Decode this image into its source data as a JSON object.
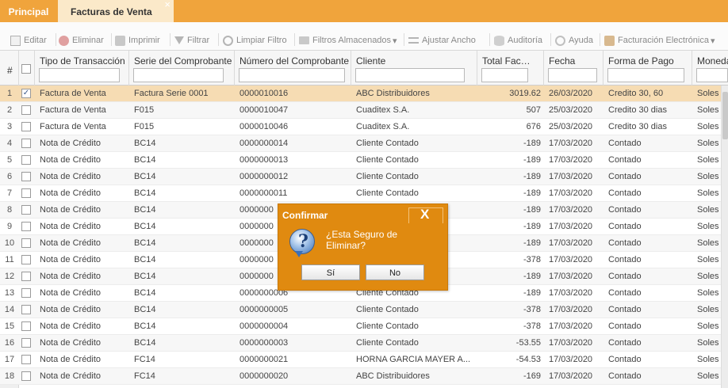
{
  "tabs": {
    "principal": "Principal",
    "facturas": "Facturas de Venta",
    "close_symbol": "×"
  },
  "toolbar": [
    {
      "label": "Editar",
      "icon": "edit-icon"
    },
    {
      "label": "Eliminar",
      "icon": "delete-icon"
    },
    {
      "label": "Imprimir",
      "icon": "print-icon"
    },
    {
      "label": "Filtrar",
      "icon": "filter-icon"
    },
    {
      "label": "Limpiar Filtro",
      "icon": "clear-filter-icon"
    },
    {
      "label": "Filtros Almacenados",
      "icon": "folder-icon",
      "dropdown": true
    },
    {
      "label": "Ajustar Ancho",
      "icon": "resize-icon"
    },
    {
      "label": "Auditoría",
      "icon": "database-icon"
    },
    {
      "label": "Ayuda",
      "icon": "help-icon"
    },
    {
      "label": "Facturación Electrónica",
      "icon": "upload-icon",
      "dropdown": true
    }
  ],
  "grid": {
    "rownum_header": "#",
    "columns": [
      {
        "key": "tipo",
        "label": "Tipo de Transacción"
      },
      {
        "key": "serie",
        "label": "Serie del Comprobante"
      },
      {
        "key": "numero",
        "label": "Número del Comprobante"
      },
      {
        "key": "cliente",
        "label": "Cliente"
      },
      {
        "key": "total",
        "label": "Total Fac…"
      },
      {
        "key": "fecha",
        "label": "Fecha"
      },
      {
        "key": "pago",
        "label": "Forma de Pago"
      },
      {
        "key": "moneda",
        "label": "Moneda"
      }
    ],
    "rows": [
      {
        "n": "1",
        "checked": true,
        "tipo": "Factura de Venta",
        "serie": "Factura Serie 0001",
        "numero": "0000010016",
        "cliente": "ABC Distribuidores",
        "total": "3019.62",
        "fecha": "26/03/2020",
        "pago": "Credito 30, 60",
        "moneda": "Soles"
      },
      {
        "n": "2",
        "tipo": "Factura de Venta",
        "serie": "F015",
        "numero": "0000010047",
        "cliente": "Cuaditex S.A.",
        "total": "507",
        "fecha": "25/03/2020",
        "pago": "Credito 30 dias",
        "moneda": "Soles"
      },
      {
        "n": "3",
        "tipo": "Factura de Venta",
        "serie": "F015",
        "numero": "0000010046",
        "cliente": "Cuaditex S.A.",
        "total": "676",
        "fecha": "25/03/2020",
        "pago": "Credito 30 dias",
        "moneda": "Soles"
      },
      {
        "n": "4",
        "tipo": "Nota de Crédito",
        "serie": "BC14",
        "numero": "0000000014",
        "cliente": "Cliente Contado",
        "total": "-189",
        "fecha": "17/03/2020",
        "pago": "Contado",
        "moneda": "Soles"
      },
      {
        "n": "5",
        "tipo": "Nota de Crédito",
        "serie": "BC14",
        "numero": "0000000013",
        "cliente": "Cliente Contado",
        "total": "-189",
        "fecha": "17/03/2020",
        "pago": "Contado",
        "moneda": "Soles"
      },
      {
        "n": "6",
        "tipo": "Nota de Crédito",
        "serie": "BC14",
        "numero": "0000000012",
        "cliente": "Cliente Contado",
        "total": "-189",
        "fecha": "17/03/2020",
        "pago": "Contado",
        "moneda": "Soles"
      },
      {
        "n": "7",
        "tipo": "Nota de Crédito",
        "serie": "BC14",
        "numero": "0000000011",
        "cliente": "Cliente Contado",
        "total": "-189",
        "fecha": "17/03/2020",
        "pago": "Contado",
        "moneda": "Soles"
      },
      {
        "n": "8",
        "tipo": "Nota de Crédito",
        "serie": "BC14",
        "numero": "0000000",
        "cliente": "",
        "total": "-189",
        "fecha": "17/03/2020",
        "pago": "Contado",
        "moneda": "Soles"
      },
      {
        "n": "9",
        "tipo": "Nota de Crédito",
        "serie": "BC14",
        "numero": "0000000",
        "cliente": "",
        "total": "-189",
        "fecha": "17/03/2020",
        "pago": "Contado",
        "moneda": "Soles"
      },
      {
        "n": "10",
        "tipo": "Nota de Crédito",
        "serie": "BC14",
        "numero": "0000000",
        "cliente": "",
        "total": "-189",
        "fecha": "17/03/2020",
        "pago": "Contado",
        "moneda": "Soles"
      },
      {
        "n": "11",
        "tipo": "Nota de Crédito",
        "serie": "BC14",
        "numero": "0000000",
        "cliente": "",
        "total": "-378",
        "fecha": "17/03/2020",
        "pago": "Contado",
        "moneda": "Soles"
      },
      {
        "n": "12",
        "tipo": "Nota de Crédito",
        "serie": "BC14",
        "numero": "0000000",
        "cliente": "",
        "total": "-189",
        "fecha": "17/03/2020",
        "pago": "Contado",
        "moneda": "Soles"
      },
      {
        "n": "13",
        "tipo": "Nota de Crédito",
        "serie": "BC14",
        "numero": "0000000006",
        "cliente": "Cliente Contado",
        "total": "-189",
        "fecha": "17/03/2020",
        "pago": "Contado",
        "moneda": "Soles"
      },
      {
        "n": "14",
        "tipo": "Nota de Crédito",
        "serie": "BC14",
        "numero": "0000000005",
        "cliente": "Cliente Contado",
        "total": "-378",
        "fecha": "17/03/2020",
        "pago": "Contado",
        "moneda": "Soles"
      },
      {
        "n": "15",
        "tipo": "Nota de Crédito",
        "serie": "BC14",
        "numero": "0000000004",
        "cliente": "Cliente Contado",
        "total": "-378",
        "fecha": "17/03/2020",
        "pago": "Contado",
        "moneda": "Soles"
      },
      {
        "n": "16",
        "tipo": "Nota de Crédito",
        "serie": "BC14",
        "numero": "0000000003",
        "cliente": "Cliente Contado",
        "total": "-53.55",
        "fecha": "17/03/2020",
        "pago": "Contado",
        "moneda": "Soles"
      },
      {
        "n": "17",
        "tipo": "Nota de Crédito",
        "serie": "FC14",
        "numero": "0000000021",
        "cliente": "HORNA GARCIA MAYER A...",
        "total": "-54.53",
        "fecha": "17/03/2020",
        "pago": "Contado",
        "moneda": "Soles"
      },
      {
        "n": "18",
        "tipo": "Nota de Crédito",
        "serie": "FC14",
        "numero": "0000000020",
        "cliente": "ABC Distribuidores",
        "total": "-169",
        "fecha": "17/03/2020",
        "pago": "Contado",
        "moneda": "Soles"
      }
    ]
  },
  "dialog": {
    "title": "Confirmar",
    "close_symbol": "X",
    "icon": "question-icon",
    "icon_glyph": "?",
    "message": "¿Esta Seguro de Eliminar?",
    "yes": "Sí",
    "no": "No"
  },
  "colors": {
    "accent": "#f0a43c",
    "dialog": "#e08a10",
    "selected_row": "#f6dcb3"
  }
}
